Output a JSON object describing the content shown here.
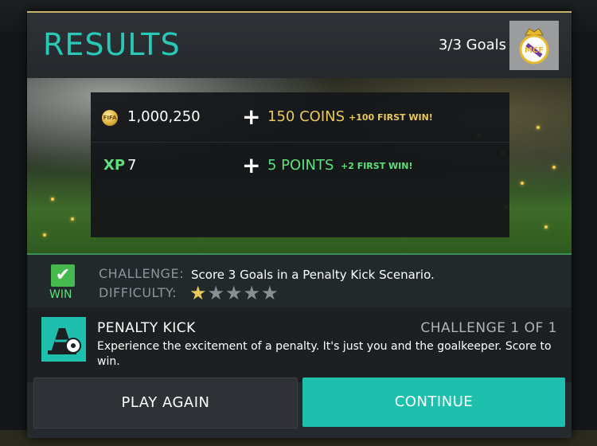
{
  "header": {
    "title": "RESULTS",
    "goals": "3/3 Goals",
    "crest": "real-madrid-crest"
  },
  "rewards": {
    "coins": {
      "icon": "coin-icon",
      "icon_text": "FIFA",
      "current": "1,000,250",
      "gain": "150 COINS",
      "bonus": "+100 FIRST WIN!"
    },
    "xp": {
      "label": "XP",
      "current": "7",
      "gain": "5 POINTS",
      "bonus": "+2 FIRST WIN!"
    },
    "plus_symbol": "+"
  },
  "challenge": {
    "status": "WIN",
    "challenge_key": "CHALLENGE:",
    "challenge_value": "Score 3 Goals in a Penalty Kick Scenario.",
    "difficulty_key": "DIFFICULTY:",
    "difficulty_rating": 1,
    "difficulty_max": 5
  },
  "mode": {
    "icon": "penalty-kick-icon",
    "title": "PENALTY KICK",
    "count": "CHALLENGE 1 OF 1",
    "description": "Experience the excitement of a penalty. It's just you and the goalkeeper. Score to win."
  },
  "buttons": {
    "play_again": "PLAY AGAIN",
    "continue": "CONTINUE"
  },
  "colors": {
    "accent": "#1fbfae",
    "gold": "#e8c95a",
    "green": "#5ee07a"
  }
}
